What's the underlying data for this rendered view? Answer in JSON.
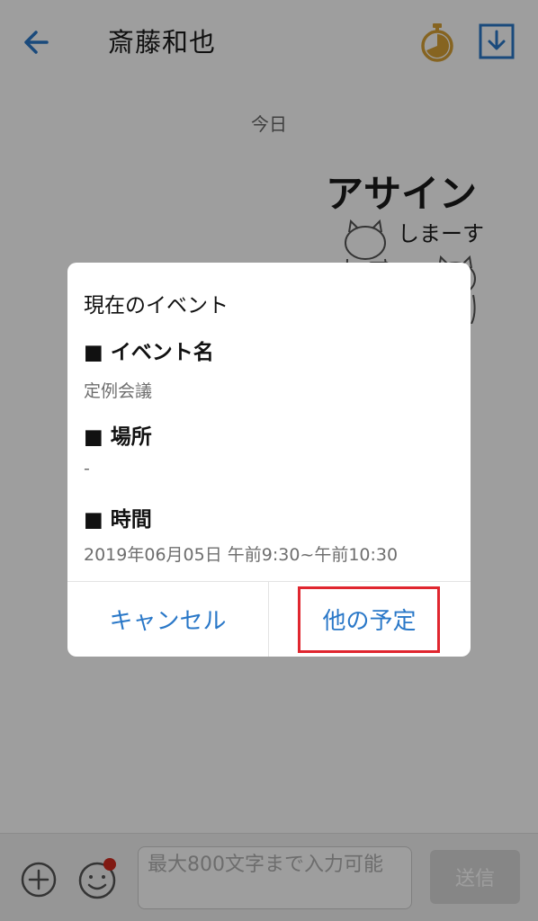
{
  "header": {
    "title": "斎藤和也",
    "back_icon": "arrow-left-icon",
    "timer_icon": "stopwatch-icon",
    "download_icon": "download-icon",
    "accent": "#2a78c8",
    "timer_color": "#d9a236"
  },
  "chat": {
    "date_label": "今日",
    "sticker": {
      "line1": "アサイン",
      "line2": "しまーす"
    }
  },
  "dialog": {
    "title": "現在のイベント",
    "sections": [
      {
        "heading": "■ イベント名",
        "value": "定例会議"
      },
      {
        "heading": "■ 場所",
        "value": "-"
      },
      {
        "heading": "■ 時間",
        "value": "2019年06月05日 午前9:30~午前10:30"
      }
    ],
    "cancel_label": "キャンセル",
    "other_label": "他の予定",
    "highlight_color": "#e0262f"
  },
  "footer": {
    "input_placeholder": "最大800文字まで入力可能",
    "send_label": "送信",
    "plus_icon": "plus-circle-icon",
    "emoji_icon": "smiley-icon"
  }
}
